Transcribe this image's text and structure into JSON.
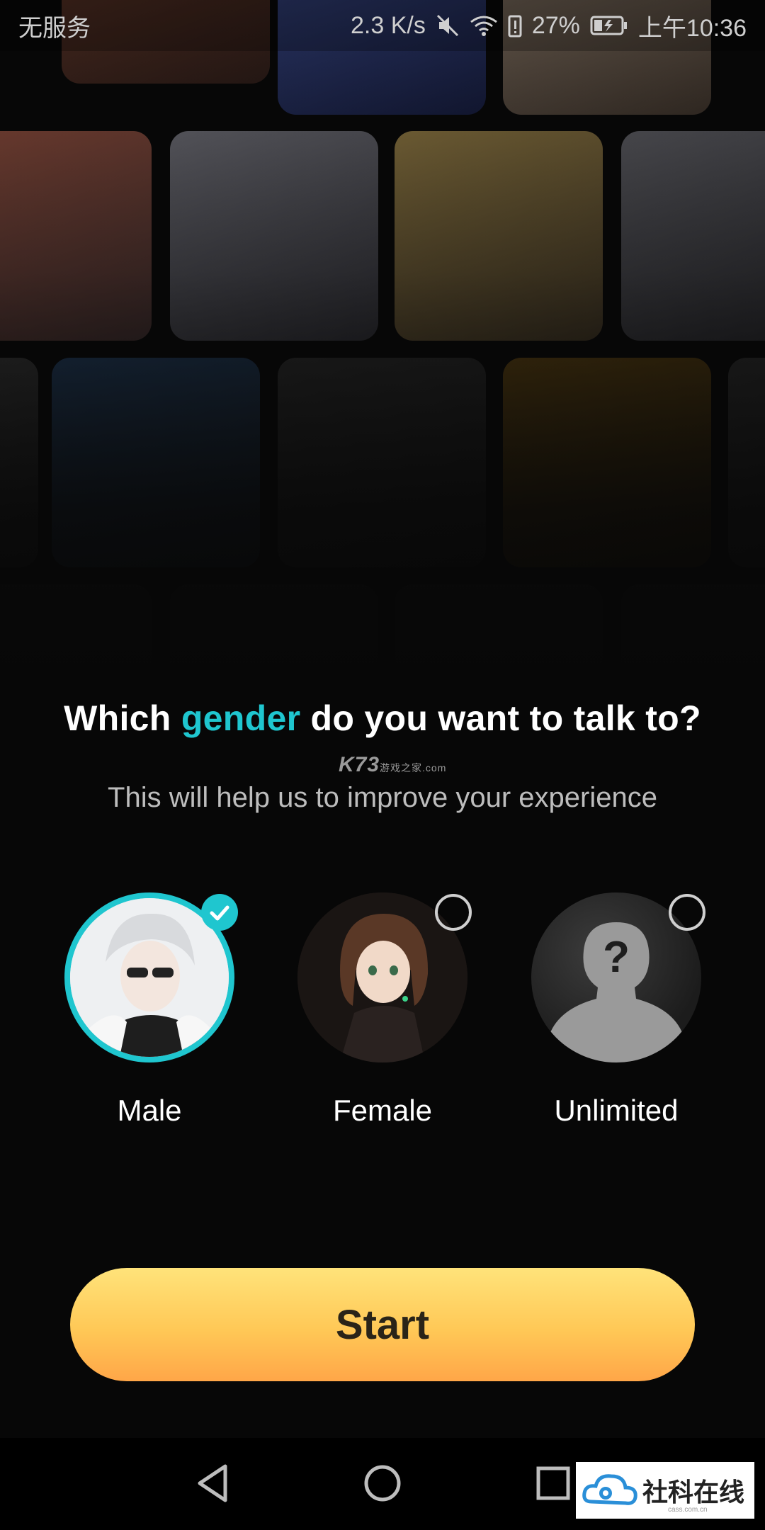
{
  "status_bar": {
    "carrier": "无服务",
    "net_speed": "2.3 K/s",
    "battery": "27%",
    "time": "上午10:36"
  },
  "colors": {
    "accent": "#1fc6cf",
    "button_top": "#ffe37a",
    "button_bottom": "#ffa648",
    "background": "#070707"
  },
  "question": {
    "prefix": "Which ",
    "highlight": "gender",
    "suffix": " do you want to talk to?"
  },
  "subtitle": "This will help us to improve your experience",
  "watermark": {
    "brand": "K73",
    "cn": "游戏之家",
    "domain": ".com"
  },
  "options": [
    {
      "label": "Male",
      "selected": true,
      "icon": "male-avatar"
    },
    {
      "label": "Female",
      "selected": false,
      "icon": "female-avatar"
    },
    {
      "label": "Unlimited",
      "selected": false,
      "icon": "unknown-person-icon",
      "glyph": "?"
    }
  ],
  "start_label": "Start",
  "corner_badge": {
    "text": "社科在线",
    "sub": "cass.com.cn"
  }
}
